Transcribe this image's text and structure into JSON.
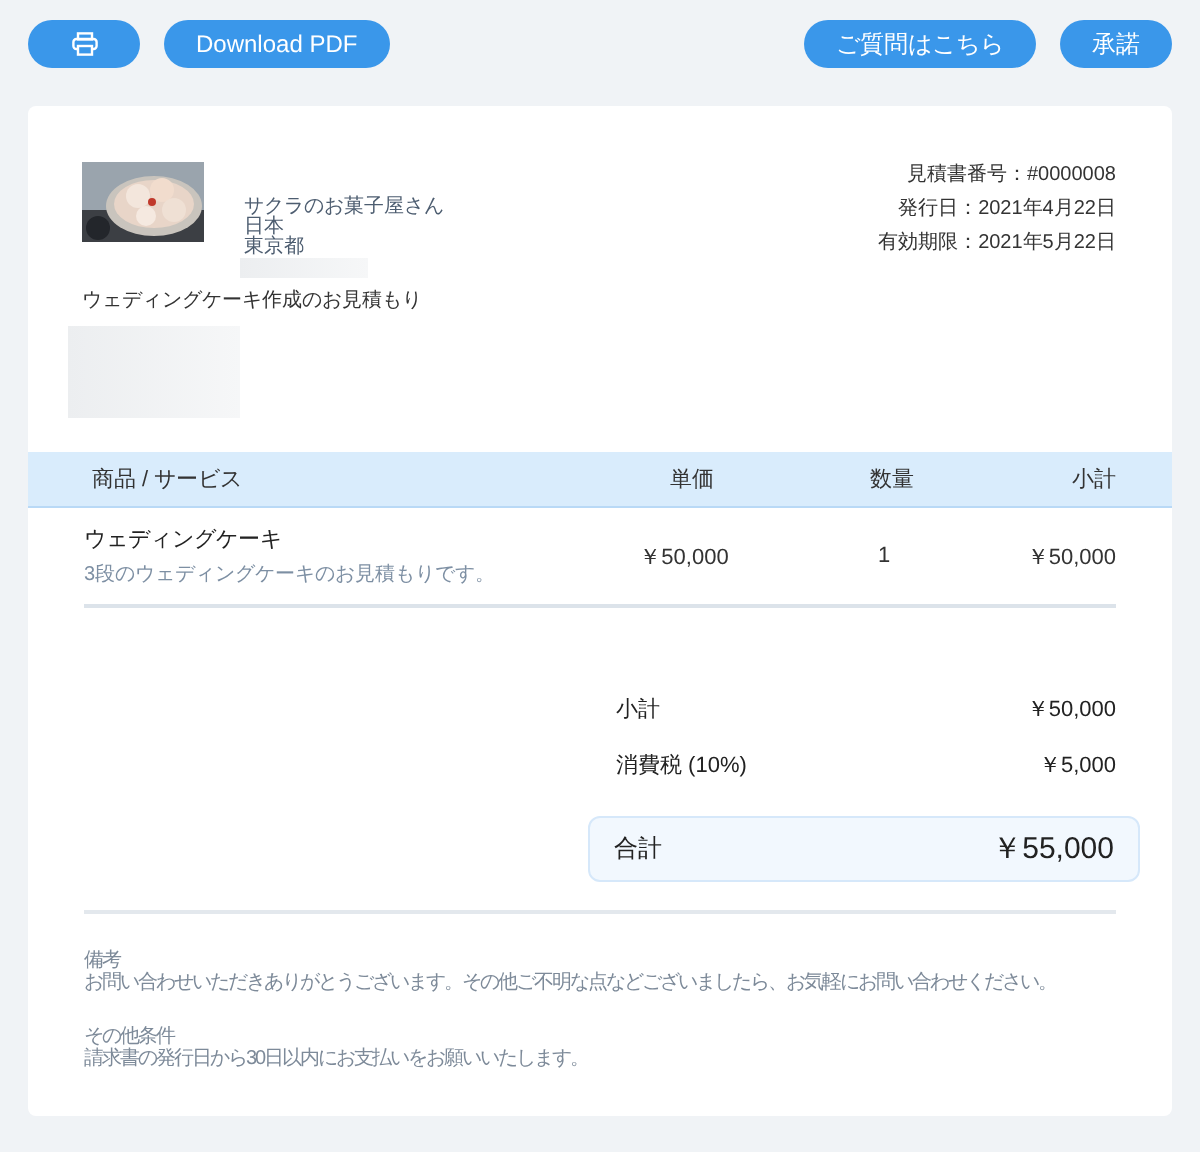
{
  "toolbar": {
    "left": [
      {
        "kind": "print"
      },
      {
        "kind": "text",
        "label": "Download PDF"
      }
    ],
    "right": [
      {
        "label": "ご質問はこちら"
      },
      {
        "label": "承諾"
      }
    ]
  },
  "customer": {
    "logo": {
      "kind": "picture"
    },
    "lines": [
      "サクラのお菓子屋さん",
      "日本",
      "東京都"
    ]
  },
  "meta": [
    "見積書番号：#0000008",
    "発行日：2021年4月22日",
    "有効期限：2021年5月22日"
  ],
  "title": "ウェディングケーキ作成のお見積もり",
  "table": {
    "columns": [
      "商品 / サービス",
      "単価",
      "数量",
      "小計"
    ],
    "rows": [
      {
        "name": "ウェディングケーキ",
        "description": "3段のウェディングケーキのお見積もりです。",
        "price": "￥50,000",
        "qty": "1",
        "subtotal": "￥50,000"
      }
    ]
  },
  "summary": [
    {
      "label": "小計",
      "value": "￥50,000"
    },
    {
      "label": "消費税 (10%)",
      "value": "￥5,000"
    }
  ],
  "total": {
    "label": "合計",
    "value": "￥55,000"
  },
  "notes": [
    {
      "heading": "備考",
      "text": "お問い合わせいただきありがとうございます。その他ご不明な点などございましたら、お気軽にお問い合わせください。"
    },
    {
      "heading": "その他条件",
      "text": "請求書の発行日から30日以内にお支払いをお願いいたします。"
    }
  ]
}
